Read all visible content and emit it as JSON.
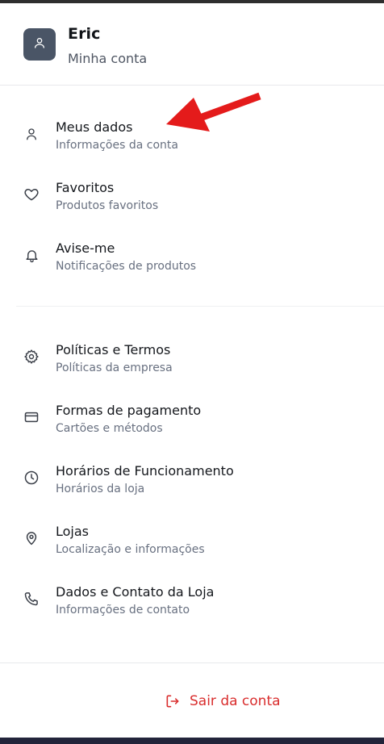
{
  "profile": {
    "name": "Eric",
    "subtitle": "Minha conta"
  },
  "sections": [
    {
      "items": [
        {
          "title": "Meus dados",
          "subtitle": "Informações da conta",
          "icon": "user-icon"
        },
        {
          "title": "Favoritos",
          "subtitle": "Produtos favoritos",
          "icon": "heart-icon"
        },
        {
          "title": "Avise-me",
          "subtitle": "Notificações de produtos",
          "icon": "bell-icon"
        }
      ]
    },
    {
      "items": [
        {
          "title": "Políticas e Termos",
          "subtitle": "Políticas da empresa",
          "icon": "gear-icon"
        },
        {
          "title": "Formas de pagamento",
          "subtitle": "Cartões e métodos",
          "icon": "credit-card-icon"
        },
        {
          "title": "Horários de Funcionamento",
          "subtitle": "Horários da loja",
          "icon": "clock-icon"
        },
        {
          "title": "Lojas",
          "subtitle": "Localização e informações",
          "icon": "map-pin-icon"
        },
        {
          "title": "Dados e Contato da Loja",
          "subtitle": "Informações de contato",
          "icon": "phone-icon"
        }
      ]
    }
  ],
  "logout": {
    "label": "Sair da conta",
    "icon": "logout-icon"
  },
  "colors": {
    "avatar_bg": "#4a5566",
    "logout": "#d92d2d",
    "annotation_arrow": "#e41b1b"
  }
}
